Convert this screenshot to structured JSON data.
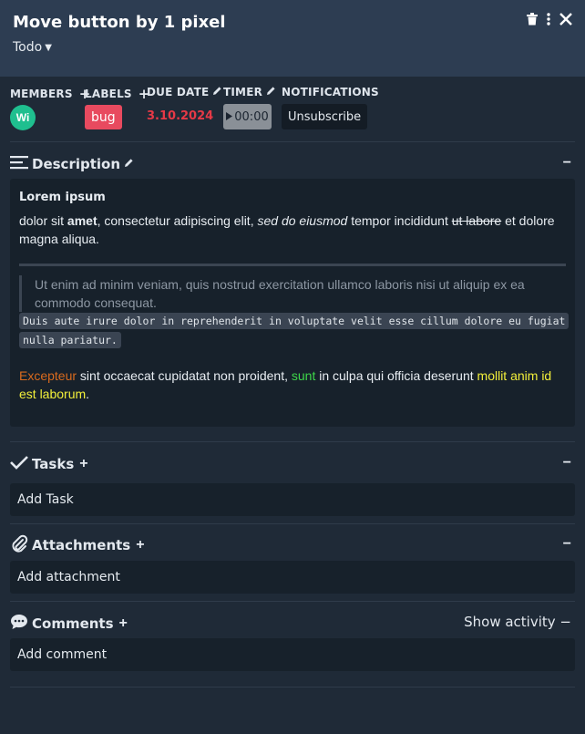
{
  "card": {
    "title": "Move button by 1 pixel",
    "list": "Todo"
  },
  "header_icons": [
    "trash-icon",
    "more-vertical-icon",
    "close-icon"
  ],
  "sections": {
    "members": "MEMBERS",
    "labels": "LABELS",
    "due_date": "DUE DATE",
    "timer": "TIMER",
    "notifications": "NOTIFICATIONS"
  },
  "members": [
    {
      "initials": "Wi",
      "color": "#1fbf8f"
    }
  ],
  "labels": [
    {
      "name": "bug",
      "color": "#e84a5f"
    }
  ],
  "due_date": {
    "value": "3.10.2024",
    "color": "#e63946"
  },
  "timer": {
    "value": "00:00"
  },
  "notifications": {
    "button": "Unsubscribe"
  },
  "description": {
    "title": "Description",
    "heading": "Lorem ipsum",
    "p1": {
      "a": "dolor sit ",
      "bold": "amet",
      "b": ", consectetur adipiscing elit, ",
      "italic": "sed do eiusmod",
      "c": " tempor incididunt ",
      "strike": "ut labore",
      "d": " et dolore magna aliqua."
    },
    "quote": "Ut enim ad minim veniam, quis nostrud exercitation ullamco laboris nisi ut aliquip ex ea commodo consequat.",
    "code": "Duis aute irure dolor in reprehenderit in voluptate velit esse cillum dolore eu fugiat nulla pariatur.",
    "p2": {
      "orange": "Excepteur",
      "a": " sint occaecat cupidatat non proident, ",
      "green": "sunt",
      "b": " in culpa qui officia deserunt ",
      "yellow": "mollit anim id est laborum",
      "c": "."
    },
    "colors": {
      "orange": "#d86a1e",
      "green": "#3ed64a",
      "yellow": "#f2ef3a"
    }
  },
  "tasks": {
    "title": "Tasks",
    "add": "Add Task"
  },
  "attachments": {
    "title": "Attachments",
    "add": "Add attachment"
  },
  "comments": {
    "title": "Comments",
    "show_activity": "Show activity",
    "add": "Add comment"
  },
  "colors": {
    "header_bg": "#2d3d52",
    "body_bg": "#1f2a37",
    "box_bg": "#17212b"
  }
}
